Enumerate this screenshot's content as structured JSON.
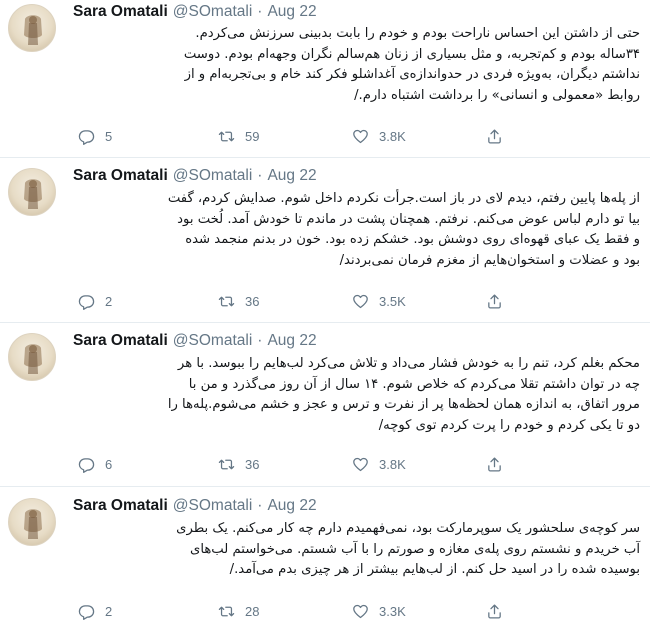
{
  "tweets": [
    {
      "name": "Sara Omatali",
      "handle": "@SOmatali",
      "dot": "·",
      "date": "Aug 22",
      "lines": [
        "حتی از داشتن این احساس ناراحت بودم و خودم را بابت بدبینی سرزنش می‌کردم.",
        "۳۴ساله بودم و کم‌تجربه، و مثل بسیاری از زنان هم‌سالم نگران وجهه‌ام بودم. دوست",
        "نداشتم دیگران، به‌ویژه فردی در حدواندازه‌ی آغداشلو فکر کند خام و بی‌تجربه‌ام و از",
        "روابط «معمولی و انسانی» را برداشت اشتباه دارم./"
      ],
      "replies": "5",
      "retweets": "59",
      "likes": "3.8K"
    },
    {
      "name": "Sara Omatali",
      "handle": "@SOmatali",
      "dot": "·",
      "date": "Aug 22",
      "lines": [
        "از پله‌ها پایین رفتم، دیدم لای در باز است.جرأت نکردم داخل شوم. صدایش کردم، گفت",
        "بیا تو دارم لباس عوض می‌کنم. نرفتم. همچنان پشت در ماندم تا خودش آمد. لُخت بود",
        "و فقط یک عبای قهوه‌ای روی دوشش بود. خشکم زده بود. خون در بدنم منجمد شده",
        "بود و عضلات و استخوان‌هایم از مغزم فرمان نمی‌بردند/"
      ],
      "replies": "2",
      "retweets": "36",
      "likes": "3.5K"
    },
    {
      "name": "Sara Omatali",
      "handle": "@SOmatali",
      "dot": "·",
      "date": "Aug 22",
      "lines": [
        "محکم بغلم کرد، تنم را به خودش فشار می‌داد و تلاش می‌کرد لب‌هایم را ببوسد. با هر",
        "چه در توان داشتم تقلا می‌کردم که خلاص شوم. ۱۴ سال از آن روز می‌گذرد و من با",
        "مرور اتفاق، به اندازه همان لحظه‌ها پر از نفرت و ترس و عجز و خشم می‌شوم.پله‌ها را",
        "دو تا یکی کردم و خودم را پرت کردم توی کوچه/"
      ],
      "replies": "6",
      "retweets": "36",
      "likes": "3.8K"
    },
    {
      "name": "Sara Omatali",
      "handle": "@SOmatali",
      "dot": "·",
      "date": "Aug 22",
      "lines": [
        "سر کوچه‌ی سلحشور یک سوپرمارکت بود، نمی‌فهمیدم دارم چه کار می‌کنم. یک بطری",
        "آب خریدم و نشستم روی پله‌ی مغازه و صورتم را با آب شستم. می‌خواستم لب‌های",
        "بوسیده شده را در اسید حل کنم. از لب‌هایم بیشتر از هر چیزی بدم می‌آمد./"
      ],
      "replies": "2",
      "retweets": "28",
      "likes": "3.3K"
    }
  ]
}
